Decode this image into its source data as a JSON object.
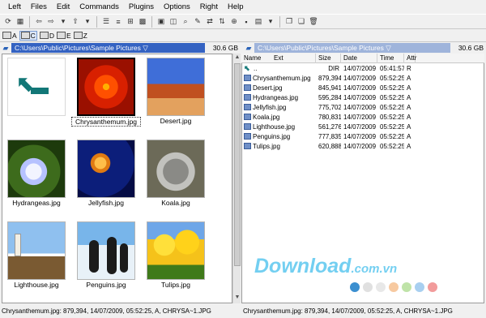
{
  "menu": [
    "Left",
    "Files",
    "Edit",
    "Commands",
    "Plugins",
    "Options",
    "Right",
    "Help"
  ],
  "drives": [
    "A",
    "C",
    "D",
    "E",
    "Z"
  ],
  "left_panel": {
    "path": "C:\\Users\\Public\\Pictures\\Sample Pictures ▽",
    "free": "30.6 GB"
  },
  "right_panel": {
    "path": "C:\\Users\\Public\\Pictures\\Sample Pictures ▽",
    "free": "30.6 GB"
  },
  "thumbnails": [
    {
      "name": "",
      "kind": "up"
    },
    {
      "name": "Chrysanthemum.jpg",
      "kind": "chrysanthemum",
      "selected": true
    },
    {
      "name": "Desert.jpg",
      "kind": "desert"
    },
    {
      "name": "Hydrangeas.jpg",
      "kind": "hydrangeas"
    },
    {
      "name": "Jellyfish.jpg",
      "kind": "jellyfish"
    },
    {
      "name": "Koala.jpg",
      "kind": "koala"
    },
    {
      "name": "Lighthouse.jpg",
      "kind": "lighthouse"
    },
    {
      "name": "Penguins.jpg",
      "kind": "penguins"
    },
    {
      "name": "Tulips.jpg",
      "kind": "tulips"
    }
  ],
  "columns": {
    "name": "Name",
    "ext": "Ext",
    "size": "Size",
    "date": "Date",
    "time": "Time",
    "attr": "Attr"
  },
  "files": [
    {
      "name": "..",
      "size": "DIR",
      "date": "14/07/2009",
      "time": "05:41:57",
      "attr": "R",
      "up": true
    },
    {
      "name": "Chrysanthemum.jpg",
      "size": "879,394",
      "date": "14/07/2009",
      "time": "05:52:25",
      "attr": "A"
    },
    {
      "name": "Desert.jpg",
      "size": "845,941",
      "date": "14/07/2009",
      "time": "05:52:25",
      "attr": "A"
    },
    {
      "name": "Hydrangeas.jpg",
      "size": "595,284",
      "date": "14/07/2009",
      "time": "05:52:25",
      "attr": "A"
    },
    {
      "name": "Jellyfish.jpg",
      "size": "775,702",
      "date": "14/07/2009",
      "time": "05:52:25",
      "attr": "A"
    },
    {
      "name": "Koala.jpg",
      "size": "780,831",
      "date": "14/07/2009",
      "time": "05:52:25",
      "attr": "A"
    },
    {
      "name": "Lighthouse.jpg",
      "size": "561,276",
      "date": "14/07/2009",
      "time": "05:52:25",
      "attr": "A"
    },
    {
      "name": "Penguins.jpg",
      "size": "777,835",
      "date": "14/07/2009",
      "time": "05:52:25",
      "attr": "A"
    },
    {
      "name": "Tulips.jpg",
      "size": "620,888",
      "date": "14/07/2009",
      "time": "05:52:25",
      "attr": "A"
    }
  ],
  "status_left": "Chrysanthemum.jpg: 879,394, 14/07/2009, 05:52:25, A, CHRYSA~1.JPG",
  "status_right": "Chrysanthemum.jpg: 879,394, 14/07/2009, 05:52:25, A, CHRYSA~1.JPG",
  "watermark": {
    "main": "Download",
    "suffix": ".com.vn"
  },
  "watermark_dots": [
    "#3b8fd0",
    "#e0e0e0",
    "#e8e8e8",
    "#f7c9a0",
    "#bfe3a8",
    "#a8cff0",
    "#f29b9b"
  ]
}
